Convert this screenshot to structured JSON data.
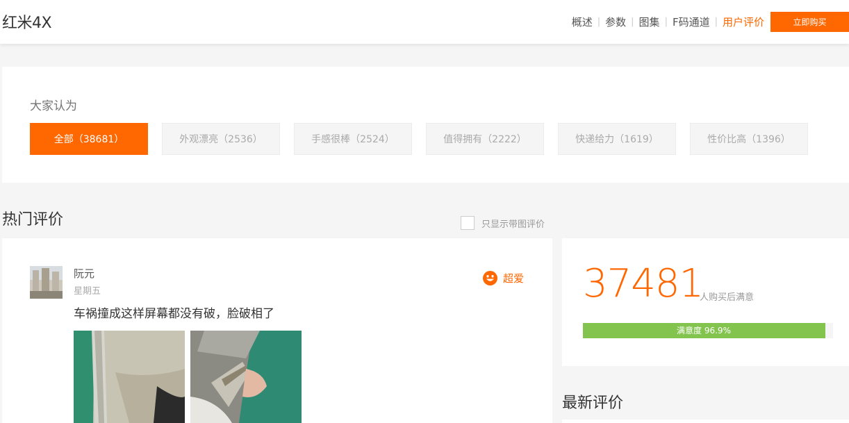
{
  "header": {
    "product_name": "红米4X",
    "nav": [
      {
        "label": "概述",
        "active": false
      },
      {
        "label": "参数",
        "active": false
      },
      {
        "label": "图集",
        "active": false
      },
      {
        "label": "F码通道",
        "active": false
      },
      {
        "label": "用户评价",
        "active": true
      }
    ],
    "buy_label": "立即购买",
    "accent_color": "#ff6700"
  },
  "tags": {
    "heading": "大家认为",
    "items": [
      {
        "label": "全部（38681）",
        "active": true
      },
      {
        "label": "外观漂亮（2536）",
        "active": false
      },
      {
        "label": "手感很棒（2524）",
        "active": false
      },
      {
        "label": "值得拥有（2222）",
        "active": false
      },
      {
        "label": "快递给力（1619）",
        "active": false
      },
      {
        "label": "性价比高（1396）",
        "active": false
      }
    ]
  },
  "hot": {
    "title": "热门评价",
    "only_pic_label": "只显示带图评价"
  },
  "review": {
    "username": "阮元",
    "date": "星期五",
    "rating_label": "超爱",
    "rating_icon": "smile-icon",
    "text": "车祸撞成这样屏幕都没有破，脸破相了"
  },
  "satisfaction": {
    "count": "37481",
    "label": "人购买后满意",
    "bar_text": "满意度 96.9%",
    "percent": 96.9,
    "bar_color": "#83c44e"
  },
  "latest": {
    "title": "最新评价"
  }
}
